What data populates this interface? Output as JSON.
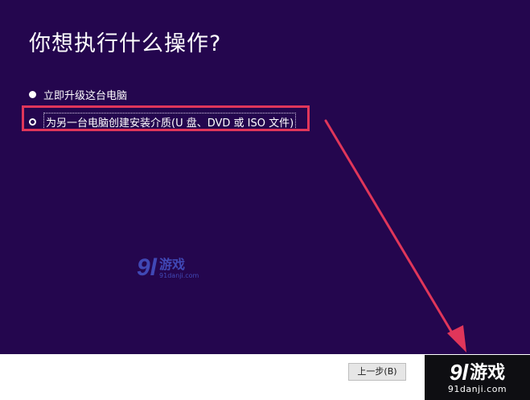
{
  "page": {
    "title": "你想执行什么操作?"
  },
  "options": [
    {
      "label": "立即升级这台电脑",
      "selected": false
    },
    {
      "label": "为另一台电脑创建安装介质(U 盘、DVD 或 ISO 文件)",
      "selected": true
    }
  ],
  "footer": {
    "back_label": "上一步(B)"
  },
  "watermark": {
    "logo_num": "9l",
    "logo_text": "游戏",
    "domain": "91danji.com"
  },
  "colors": {
    "background": "#24064e",
    "highlight": "#e0365a",
    "arrow": "#e0365a"
  },
  "icons": [
    "radio-unselected-icon",
    "radio-selected-icon",
    "arrow-annotation-icon"
  ]
}
